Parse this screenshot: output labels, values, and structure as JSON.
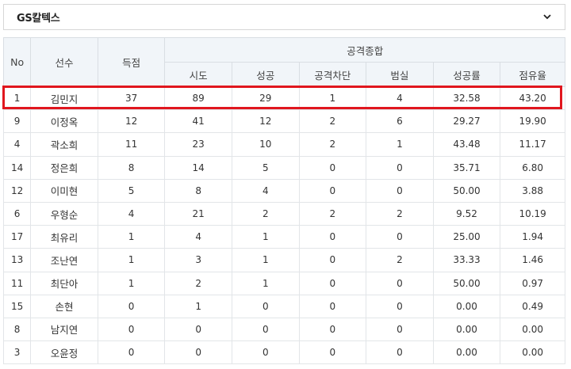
{
  "team_select": {
    "value": "GS칼텍스",
    "icon": "chevron-down-icon"
  },
  "table": {
    "headers": {
      "no": "No",
      "player": "선수",
      "points": "득점",
      "attack_group": "공격종합",
      "sub": [
        "시도",
        "성공",
        "공격차단",
        "범실",
        "성공률",
        "점유율"
      ]
    },
    "rows": [
      [
        "1",
        "김민지",
        "37",
        "89",
        "29",
        "1",
        "4",
        "32.58",
        "43.20"
      ],
      [
        "9",
        "이정옥",
        "12",
        "41",
        "12",
        "2",
        "6",
        "29.27",
        "19.90"
      ],
      [
        "4",
        "곽소희",
        "11",
        "23",
        "10",
        "2",
        "1",
        "43.48",
        "11.17"
      ],
      [
        "14",
        "정은희",
        "8",
        "14",
        "5",
        "0",
        "0",
        "35.71",
        "6.80"
      ],
      [
        "12",
        "이미현",
        "5",
        "8",
        "4",
        "0",
        "0",
        "50.00",
        "3.88"
      ],
      [
        "6",
        "우형순",
        "4",
        "21",
        "2",
        "2",
        "2",
        "9.52",
        "10.19"
      ],
      [
        "17",
        "최유리",
        "1",
        "4",
        "1",
        "0",
        "0",
        "25.00",
        "1.94"
      ],
      [
        "13",
        "조난연",
        "1",
        "3",
        "1",
        "0",
        "2",
        "33.33",
        "1.46"
      ],
      [
        "11",
        "최단아",
        "1",
        "2",
        "1",
        "0",
        "0",
        "50.00",
        "0.97"
      ],
      [
        "15",
        "손현",
        "0",
        "1",
        "0",
        "0",
        "0",
        "0.00",
        "0.49"
      ],
      [
        "8",
        "남지연",
        "0",
        "0",
        "0",
        "0",
        "0",
        "0.00",
        "0.00"
      ],
      [
        "3",
        "오윤정",
        "0",
        "0",
        "0",
        "0",
        "0",
        "0.00",
        "0.00"
      ]
    ],
    "highlight_color": "#e0161e",
    "header_bg": "#f1f5f9"
  }
}
